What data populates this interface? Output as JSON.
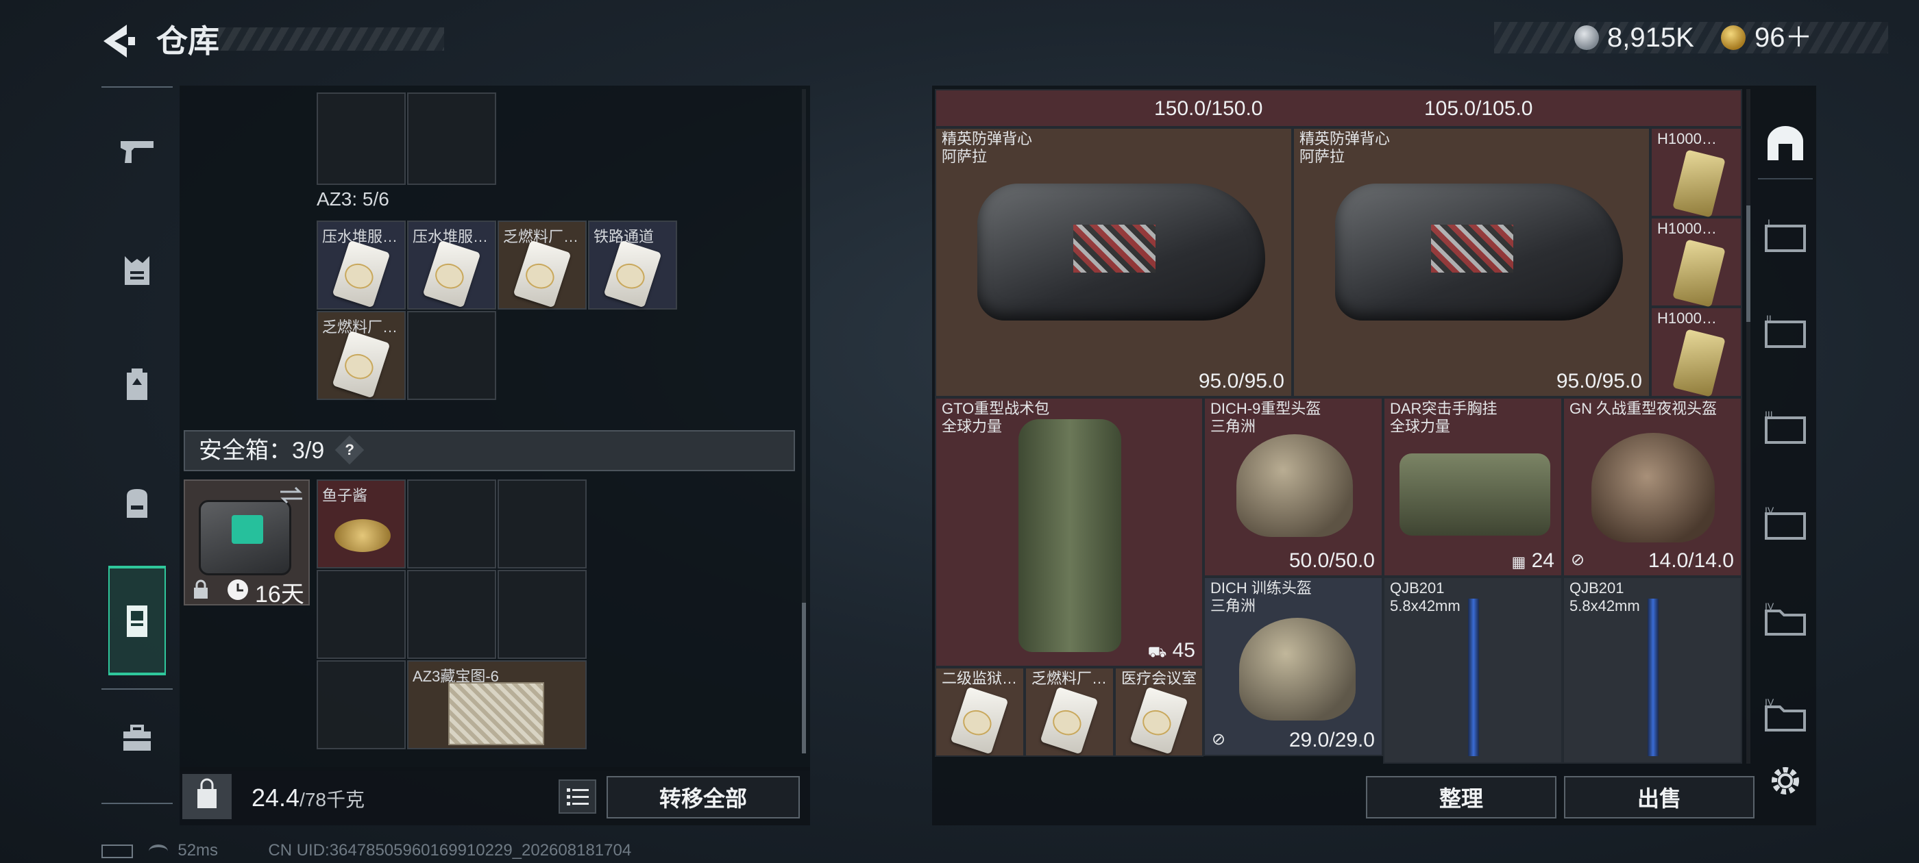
{
  "header": {
    "title": "仓库"
  },
  "currency": {
    "silver": "8,915K",
    "gold": "96＋"
  },
  "left_nav": {
    "items": [
      {
        "name": "weapons"
      },
      {
        "name": "armor"
      },
      {
        "name": "chest-rig"
      },
      {
        "name": "backpack"
      },
      {
        "name": "storage",
        "active": true
      },
      {
        "name": "briefcase"
      }
    ]
  },
  "container": {
    "az3_label": "AZ3: 5/6",
    "az3_items": [
      {
        "label": "压水堆服…"
      },
      {
        "label": "压水堆服…"
      },
      {
        "label": "乏燃料厂…"
      },
      {
        "label": "铁路通道"
      },
      {
        "label": "乏燃料厂…"
      }
    ]
  },
  "safe_box": {
    "label": "安全箱：3/9",
    "help": "?",
    "time_left": "16天",
    "items": [
      {
        "label": "鱼子酱"
      },
      {
        "label": "AZ3藏宝图-6"
      }
    ]
  },
  "weight": {
    "current": "24.4",
    "max": "/78千克"
  },
  "buttons": {
    "transfer_all": "转移全部",
    "arrange": "整理",
    "sell": "出售"
  },
  "status": {
    "ping": "52ms",
    "uid": "CN UID:3647850596016991​0229_202608181704"
  },
  "stash": {
    "top_row": [
      {
        "value": "150.0/150.0"
      },
      {
        "value": "105.0/105.0"
      }
    ],
    "vests": [
      {
        "name": "精英防弹背心",
        "sub": "阿萨拉",
        "value": "95.0/95.0"
      },
      {
        "name": "精英防弹背心",
        "sub": "阿萨拉",
        "value": "95.0/95.0"
      }
    ],
    "h_cards": [
      {
        "label": "H1000…"
      },
      {
        "label": "H1000…"
      },
      {
        "label": "H1000…"
      }
    ],
    "bag": {
      "name": "GTO重型战术包",
      "sub": "全球力量",
      "count": "45"
    },
    "helmet1": {
      "name": "DICH-9重型头盔",
      "sub": "三角洲",
      "value": "50.0/50.0"
    },
    "rig": {
      "name": "DAR突击手胸挂",
      "sub": "全球力量",
      "count": "24"
    },
    "nvg": {
      "name": "GN 久战重型夜视头盔",
      "value": "14.0/14.0"
    },
    "helmet2": {
      "name": "DICH 训练头盔",
      "sub": "三角洲",
      "value": "29.0/29.0"
    },
    "guns": [
      {
        "name": "QJB201",
        "sub": "5.8x42mm"
      },
      {
        "name": "QJB201",
        "sub": "5.8x42mm"
      }
    ],
    "small_cards": [
      {
        "label": "二级监狱…"
      },
      {
        "label": "乏燃料厂…"
      },
      {
        "label": "医疗会议室"
      }
    ]
  },
  "right_nav": {
    "items": [
      {
        "name": "home",
        "label": ""
      },
      {
        "name": "case-I",
        "label": "I"
      },
      {
        "name": "case-II",
        "label": "II"
      },
      {
        "name": "case-III",
        "label": "III"
      },
      {
        "name": "case-IV",
        "label": "IV"
      },
      {
        "name": "case-IV-b",
        "label": "IV"
      },
      {
        "name": "case-IV-c",
        "label": "IV"
      }
    ]
  },
  "colors": {
    "accent": "#2fc79b",
    "panel": "#0e1318",
    "red_slot": "#4e2d32",
    "brown_slot": "#4c3b32"
  }
}
